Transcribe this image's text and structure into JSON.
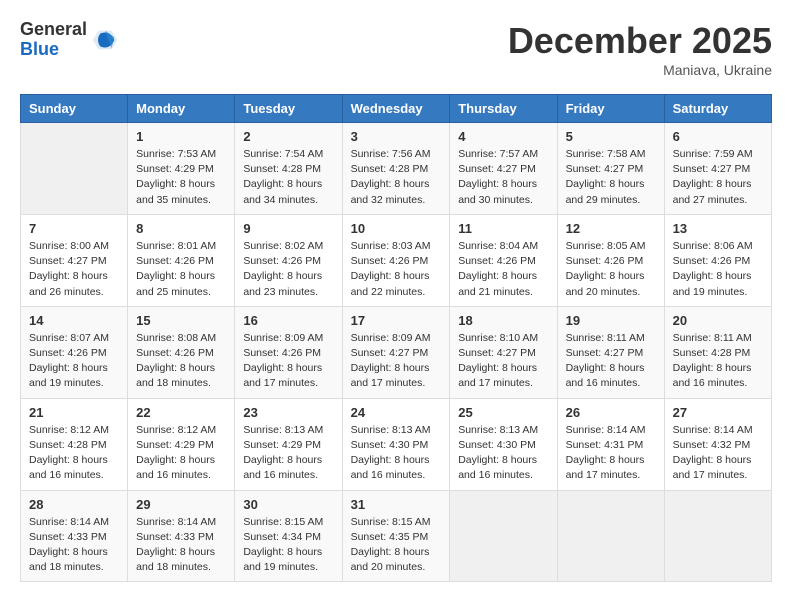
{
  "logo": {
    "general": "General",
    "blue": "Blue"
  },
  "title": "December 2025",
  "location": "Maniava, Ukraine",
  "days_header": [
    "Sunday",
    "Monday",
    "Tuesday",
    "Wednesday",
    "Thursday",
    "Friday",
    "Saturday"
  ],
  "weeks": [
    [
      {
        "day": "",
        "sunrise": "",
        "sunset": "",
        "daylight": ""
      },
      {
        "day": "1",
        "sunrise": "Sunrise: 7:53 AM",
        "sunset": "Sunset: 4:29 PM",
        "daylight": "Daylight: 8 hours and 35 minutes."
      },
      {
        "day": "2",
        "sunrise": "Sunrise: 7:54 AM",
        "sunset": "Sunset: 4:28 PM",
        "daylight": "Daylight: 8 hours and 34 minutes."
      },
      {
        "day": "3",
        "sunrise": "Sunrise: 7:56 AM",
        "sunset": "Sunset: 4:28 PM",
        "daylight": "Daylight: 8 hours and 32 minutes."
      },
      {
        "day": "4",
        "sunrise": "Sunrise: 7:57 AM",
        "sunset": "Sunset: 4:27 PM",
        "daylight": "Daylight: 8 hours and 30 minutes."
      },
      {
        "day": "5",
        "sunrise": "Sunrise: 7:58 AM",
        "sunset": "Sunset: 4:27 PM",
        "daylight": "Daylight: 8 hours and 29 minutes."
      },
      {
        "day": "6",
        "sunrise": "Sunrise: 7:59 AM",
        "sunset": "Sunset: 4:27 PM",
        "daylight": "Daylight: 8 hours and 27 minutes."
      }
    ],
    [
      {
        "day": "7",
        "sunrise": "Sunrise: 8:00 AM",
        "sunset": "Sunset: 4:27 PM",
        "daylight": "Daylight: 8 hours and 26 minutes."
      },
      {
        "day": "8",
        "sunrise": "Sunrise: 8:01 AM",
        "sunset": "Sunset: 4:26 PM",
        "daylight": "Daylight: 8 hours and 25 minutes."
      },
      {
        "day": "9",
        "sunrise": "Sunrise: 8:02 AM",
        "sunset": "Sunset: 4:26 PM",
        "daylight": "Daylight: 8 hours and 23 minutes."
      },
      {
        "day": "10",
        "sunrise": "Sunrise: 8:03 AM",
        "sunset": "Sunset: 4:26 PM",
        "daylight": "Daylight: 8 hours and 22 minutes."
      },
      {
        "day": "11",
        "sunrise": "Sunrise: 8:04 AM",
        "sunset": "Sunset: 4:26 PM",
        "daylight": "Daylight: 8 hours and 21 minutes."
      },
      {
        "day": "12",
        "sunrise": "Sunrise: 8:05 AM",
        "sunset": "Sunset: 4:26 PM",
        "daylight": "Daylight: 8 hours and 20 minutes."
      },
      {
        "day": "13",
        "sunrise": "Sunrise: 8:06 AM",
        "sunset": "Sunset: 4:26 PM",
        "daylight": "Daylight: 8 hours and 19 minutes."
      }
    ],
    [
      {
        "day": "14",
        "sunrise": "Sunrise: 8:07 AM",
        "sunset": "Sunset: 4:26 PM",
        "daylight": "Daylight: 8 hours and 19 minutes."
      },
      {
        "day": "15",
        "sunrise": "Sunrise: 8:08 AM",
        "sunset": "Sunset: 4:26 PM",
        "daylight": "Daylight: 8 hours and 18 minutes."
      },
      {
        "day": "16",
        "sunrise": "Sunrise: 8:09 AM",
        "sunset": "Sunset: 4:26 PM",
        "daylight": "Daylight: 8 hours and 17 minutes."
      },
      {
        "day": "17",
        "sunrise": "Sunrise: 8:09 AM",
        "sunset": "Sunset: 4:27 PM",
        "daylight": "Daylight: 8 hours and 17 minutes."
      },
      {
        "day": "18",
        "sunrise": "Sunrise: 8:10 AM",
        "sunset": "Sunset: 4:27 PM",
        "daylight": "Daylight: 8 hours and 17 minutes."
      },
      {
        "day": "19",
        "sunrise": "Sunrise: 8:11 AM",
        "sunset": "Sunset: 4:27 PM",
        "daylight": "Daylight: 8 hours and 16 minutes."
      },
      {
        "day": "20",
        "sunrise": "Sunrise: 8:11 AM",
        "sunset": "Sunset: 4:28 PM",
        "daylight": "Daylight: 8 hours and 16 minutes."
      }
    ],
    [
      {
        "day": "21",
        "sunrise": "Sunrise: 8:12 AM",
        "sunset": "Sunset: 4:28 PM",
        "daylight": "Daylight: 8 hours and 16 minutes."
      },
      {
        "day": "22",
        "sunrise": "Sunrise: 8:12 AM",
        "sunset": "Sunset: 4:29 PM",
        "daylight": "Daylight: 8 hours and 16 minutes."
      },
      {
        "day": "23",
        "sunrise": "Sunrise: 8:13 AM",
        "sunset": "Sunset: 4:29 PM",
        "daylight": "Daylight: 8 hours and 16 minutes."
      },
      {
        "day": "24",
        "sunrise": "Sunrise: 8:13 AM",
        "sunset": "Sunset: 4:30 PM",
        "daylight": "Daylight: 8 hours and 16 minutes."
      },
      {
        "day": "25",
        "sunrise": "Sunrise: 8:13 AM",
        "sunset": "Sunset: 4:30 PM",
        "daylight": "Daylight: 8 hours and 16 minutes."
      },
      {
        "day": "26",
        "sunrise": "Sunrise: 8:14 AM",
        "sunset": "Sunset: 4:31 PM",
        "daylight": "Daylight: 8 hours and 17 minutes."
      },
      {
        "day": "27",
        "sunrise": "Sunrise: 8:14 AM",
        "sunset": "Sunset: 4:32 PM",
        "daylight": "Daylight: 8 hours and 17 minutes."
      }
    ],
    [
      {
        "day": "28",
        "sunrise": "Sunrise: 8:14 AM",
        "sunset": "Sunset: 4:33 PM",
        "daylight": "Daylight: 8 hours and 18 minutes."
      },
      {
        "day": "29",
        "sunrise": "Sunrise: 8:14 AM",
        "sunset": "Sunset: 4:33 PM",
        "daylight": "Daylight: 8 hours and 18 minutes."
      },
      {
        "day": "30",
        "sunrise": "Sunrise: 8:15 AM",
        "sunset": "Sunset: 4:34 PM",
        "daylight": "Daylight: 8 hours and 19 minutes."
      },
      {
        "day": "31",
        "sunrise": "Sunrise: 8:15 AM",
        "sunset": "Sunset: 4:35 PM",
        "daylight": "Daylight: 8 hours and 20 minutes."
      },
      {
        "day": "",
        "sunrise": "",
        "sunset": "",
        "daylight": ""
      },
      {
        "day": "",
        "sunrise": "",
        "sunset": "",
        "daylight": ""
      },
      {
        "day": "",
        "sunrise": "",
        "sunset": "",
        "daylight": ""
      }
    ]
  ]
}
